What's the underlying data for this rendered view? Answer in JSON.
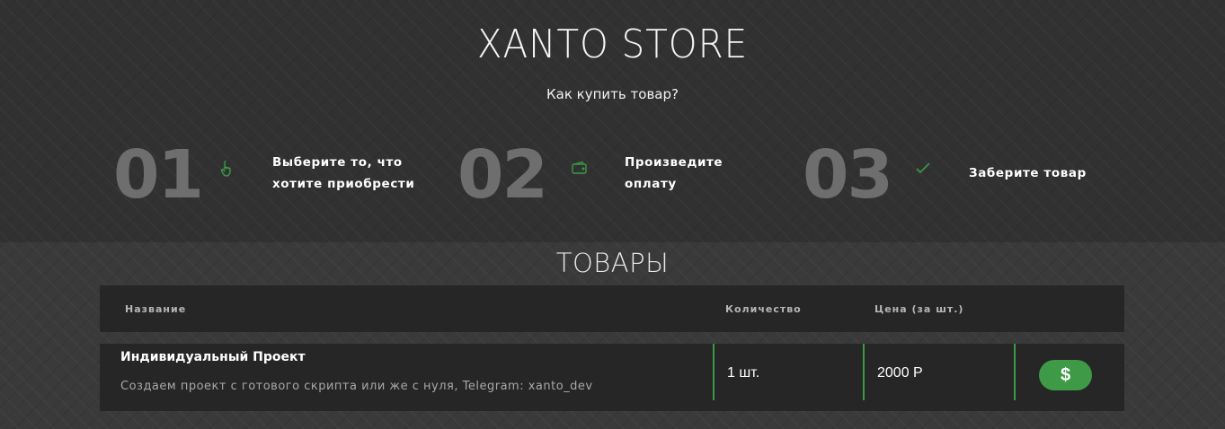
{
  "header": {
    "brand": "XANTO STORE",
    "subtitle": "Как купить товар?"
  },
  "steps": [
    {
      "number": "01",
      "icon": "hand-pointer-icon",
      "text_line1": "Выберите то, что",
      "text_line2": "хотите приобрести"
    },
    {
      "number": "02",
      "icon": "wallet-icon",
      "text_line1": "Произведите",
      "text_line2": "оплату"
    },
    {
      "number": "03",
      "icon": "checkmark-icon",
      "text_line1": "Заберите товар",
      "text_line2": ""
    }
  ],
  "products": {
    "title": "ТОВАРЫ",
    "columns": {
      "name": "Название",
      "quantity": "Количество",
      "price": "Цена (за шт.)"
    },
    "rows": [
      {
        "name": "Индивидуальный Проект",
        "description": "Создаем проект с готового скрипта или же с нуля, Telegram: xanto_dev",
        "quantity": "1 шт.",
        "price": "2000 Р",
        "buy_label": "$"
      }
    ]
  },
  "colors": {
    "accent": "#3e9a47",
    "background": "#3a3a3a",
    "panel": "#262626",
    "step_number": "#6e6e6e"
  }
}
